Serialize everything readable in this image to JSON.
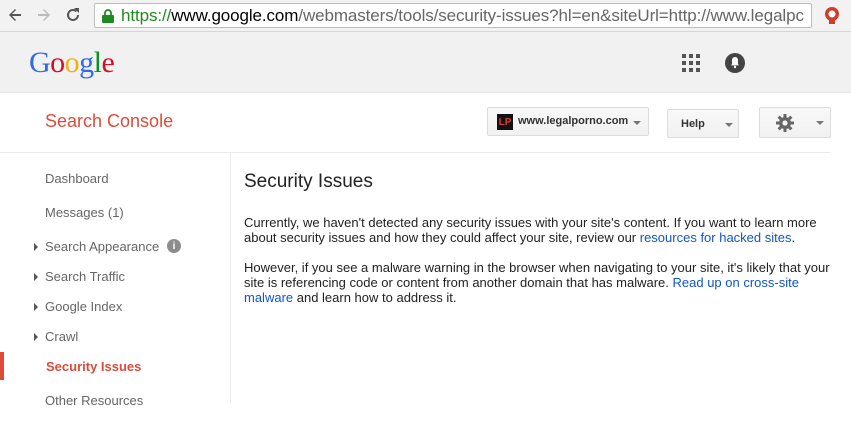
{
  "browser": {
    "url_scheme": "https://",
    "url_host": "www.google.com",
    "url_path": "/webmasters/tools/security-issues?hl=en&siteUrl=http://www.legalpc"
  },
  "google_bar": {
    "logo_letters": [
      "G",
      "o",
      "o",
      "g",
      "l",
      "e"
    ],
    "logo_colors": [
      "#3369e8",
      "#d50f25",
      "#eeb211",
      "#3369e8",
      "#009925",
      "#d50f25"
    ]
  },
  "header": {
    "product_title": "Search Console",
    "site_selector": {
      "favicon_text": "LP",
      "label": "www.legalporno.com"
    },
    "help_label": "Help"
  },
  "sidebar": {
    "items": [
      {
        "label": "Dashboard",
        "expandable": false
      },
      {
        "label": "Messages (1)",
        "expandable": false
      },
      {
        "label": "Search Appearance",
        "expandable": true,
        "info": "i"
      },
      {
        "label": "Search Traffic",
        "expandable": true
      },
      {
        "label": "Google Index",
        "expandable": true
      },
      {
        "label": "Crawl",
        "expandable": true
      },
      {
        "label": "Security Issues",
        "expandable": false,
        "active": true
      },
      {
        "label": "Other Resources",
        "expandable": false
      }
    ]
  },
  "main": {
    "title": "Security Issues",
    "para1_text": "Currently, we haven't detected any security issues with your site's content. If you want to learn more about security issues and how they could affect your site, review our ",
    "para1_link": "resources for hacked sites",
    "para1_end": ".",
    "para2_text": "However, if you see a malware warning in the browser when navigating to your site, it's likely that your site is referencing code or content from another domain that has malware. ",
    "para2_link": "Read up on cross-site malware",
    "para2_end": " and learn how to address it."
  },
  "colors": {
    "accent_red": "#dd4b39",
    "link_blue": "#1155cc",
    "secure_green": "#1e8a21"
  }
}
